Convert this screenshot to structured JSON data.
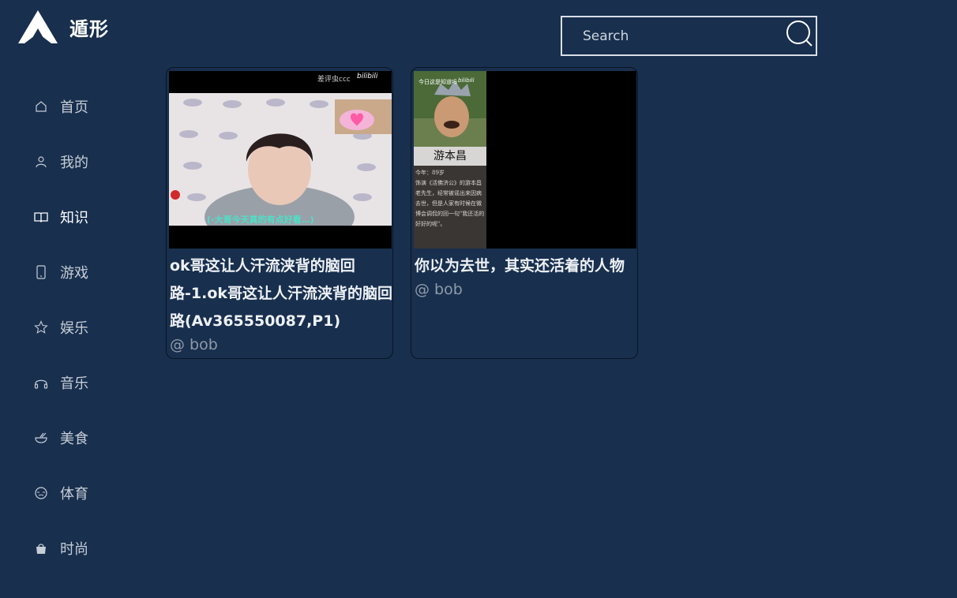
{
  "brand": {
    "name": "遁形"
  },
  "search": {
    "placeholder": "Search"
  },
  "nav": {
    "items": [
      {
        "label": "首页",
        "icon": "home-icon"
      },
      {
        "label": "我的",
        "icon": "user-icon"
      },
      {
        "label": "知识",
        "icon": "book-icon",
        "active": true
      },
      {
        "label": "游戏",
        "icon": "phone-icon"
      },
      {
        "label": "娱乐",
        "icon": "star-icon"
      },
      {
        "label": "音乐",
        "icon": "headphones-icon"
      },
      {
        "label": "美食",
        "icon": "bowl-icon"
      },
      {
        "label": "体育",
        "icon": "ball-icon"
      },
      {
        "label": "时尚",
        "icon": "bag-icon"
      }
    ]
  },
  "videos": [
    {
      "title": "ok哥这让人汗流浃背的脑回路-1.ok哥这让人汗流浃背的脑回路(Av365550087,P1)",
      "author": "@ bob",
      "thumb": {
        "watermark": "差评虫ccc",
        "platform": "bilibili",
        "subtitle": "(-大哥今天真的有点好看…)"
      }
    },
    {
      "title": "你以为去世，其实还活着的人物",
      "author": "@ bob",
      "thumb": {
        "header": "今日这是知道吗",
        "platform": "bilibili",
        "name": "游本昌",
        "age": "今年：89岁",
        "desc": "饰演《活佛济公》的游本昌老先生，经常被谣出来因病去世，但是人家有时候在微博会调侃的回一句\"我还活的好好的呢\"。"
      }
    }
  ]
}
